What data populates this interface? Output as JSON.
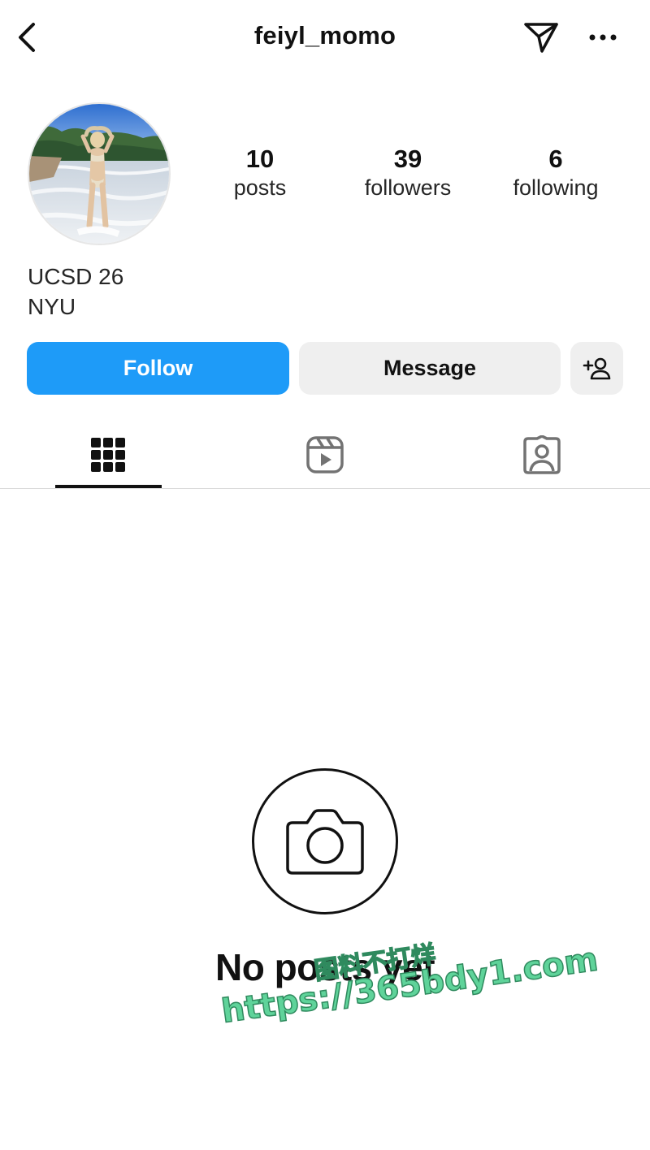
{
  "header": {
    "username": "feiyl_momo",
    "back_icon": "chevron-left-icon",
    "send_icon": "paper-plane-icon",
    "more_icon": "ellipsis-icon"
  },
  "profile": {
    "avatar_description": "profile photo",
    "stats": [
      {
        "value": "10",
        "label": "posts"
      },
      {
        "value": "39",
        "label": "followers"
      },
      {
        "value": "6",
        "label": "following"
      }
    ],
    "bio": [
      "UCSD 26",
      "NYU"
    ]
  },
  "actions": {
    "follow_label": "Follow",
    "message_label": "Message",
    "adduser_icon": "add-person-icon"
  },
  "tabs": [
    {
      "name": "posts-grid",
      "icon": "grid-icon",
      "active": true
    },
    {
      "name": "reels",
      "icon": "reels-icon",
      "active": false
    },
    {
      "name": "tagged",
      "icon": "tagged-icon",
      "active": false
    }
  ],
  "empty_state": {
    "icon": "camera-icon",
    "text": "No posts yet"
  },
  "watermark": {
    "line1": "图料不打烊",
    "line2": "https://365bdy1.com"
  },
  "colors": {
    "follow_button": "#1e9bf8",
    "secondary_button": "#efefef",
    "text": "#111111",
    "watermark": "#5fd39a"
  }
}
